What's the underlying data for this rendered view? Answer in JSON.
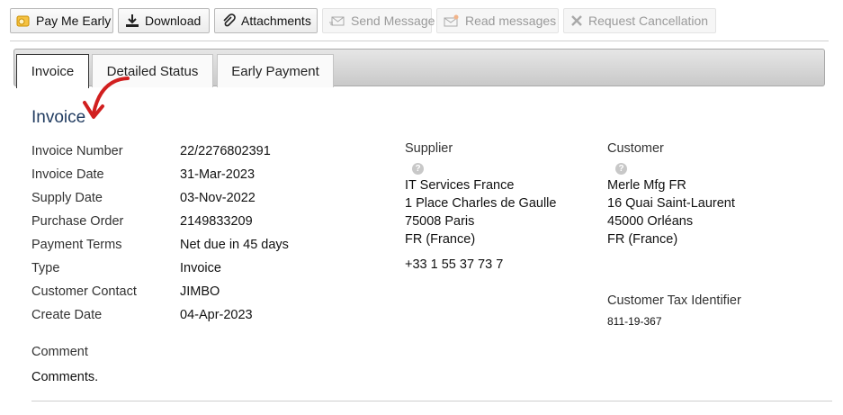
{
  "toolbar": {
    "buttons": [
      {
        "label": "Pay Me Early",
        "icon": "pay-me-early-icon",
        "enabled": true
      },
      {
        "label": "Download",
        "icon": "download-icon",
        "enabled": true
      },
      {
        "label": "Attachments",
        "icon": "paperclip-icon",
        "enabled": true
      },
      {
        "label": "Send Message",
        "icon": "send-message-icon",
        "enabled": false
      },
      {
        "label": "Read messages",
        "icon": "read-messages-icon",
        "enabled": false
      },
      {
        "label": "Request Cancellation",
        "icon": "close-icon",
        "enabled": false
      }
    ]
  },
  "tabs": [
    {
      "label": "Invoice",
      "active": true
    },
    {
      "label": "Detailed Status",
      "active": false
    },
    {
      "label": "Early Payment",
      "active": false
    }
  ],
  "invoice": {
    "title": "Invoice",
    "fields": [
      {
        "label": "Invoice Number",
        "value": "22/2276802391"
      },
      {
        "label": "Invoice Date",
        "value": "31-Mar-2023"
      },
      {
        "label": "Supply Date",
        "value": "03-Nov-2022"
      },
      {
        "label": "Purchase Order",
        "value": "2149833209"
      },
      {
        "label": "Payment Terms",
        "value": "Net due in 45 days"
      },
      {
        "label": "Type",
        "value": "Invoice"
      },
      {
        "label": "Customer Contact",
        "value": "JIMBO"
      },
      {
        "label": "Create Date",
        "value": "04-Apr-2023"
      }
    ],
    "comment_label": "Comment",
    "comment_value": "Comments."
  },
  "supplier": {
    "heading": "Supplier",
    "name": "IT Services France",
    "address1": "1 Place Charles de Gaulle",
    "address2": "75008 Paris",
    "country": "FR (France)",
    "phone": "+33 1 55 37 73 7"
  },
  "customer": {
    "heading": "Customer",
    "name": "Merle Mfg FR",
    "address1": "16 Quai Saint-Laurent",
    "address2": "45000 Orléans",
    "country": "FR (France)",
    "tax_label": "Customer Tax Identifier",
    "tax_value": "811-19-367"
  },
  "colors": {
    "title": "#1f3a5f",
    "annotation_arrow": "#d11f1f",
    "disabled_text": "#9a9a9a"
  }
}
